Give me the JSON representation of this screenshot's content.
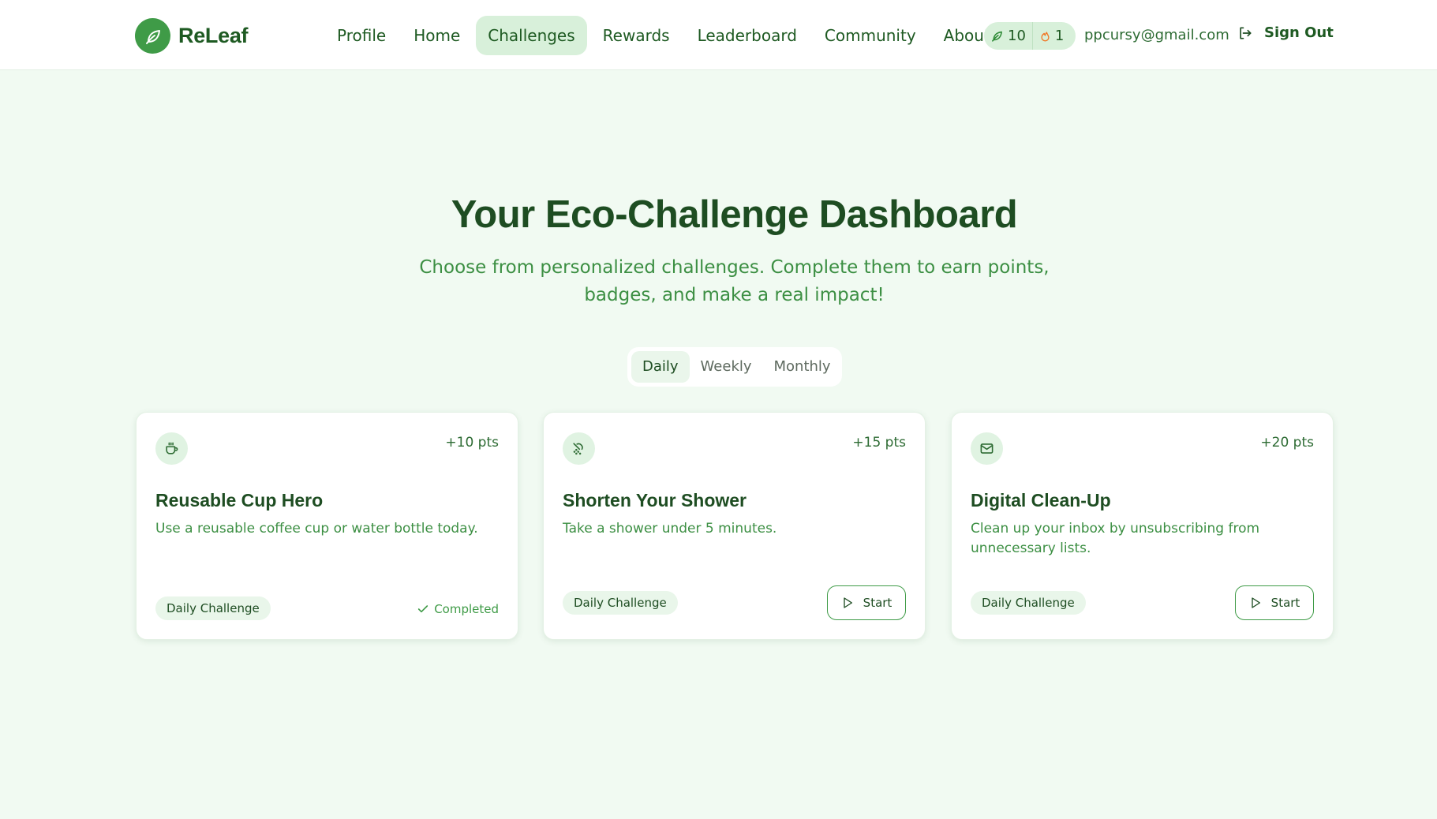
{
  "brand": {
    "name": "ReLeaf",
    "logo_icon": "leaf-icon"
  },
  "nav": {
    "items": [
      "Profile",
      "Home",
      "Challenges",
      "Rewards",
      "Leaderboard",
      "Community",
      "About"
    ],
    "active": "Challenges"
  },
  "stats": {
    "leaves": "10",
    "streak": "1"
  },
  "user": {
    "email": "ppcursy@gmail.com",
    "sign_out_label": "Sign Out"
  },
  "hero": {
    "title": "Your Eco-Challenge Dashboard",
    "subtitle": "Choose from personalized challenges. Complete them to earn points, badges, and make a real impact!"
  },
  "tabs": {
    "items": [
      "Daily",
      "Weekly",
      "Monthly"
    ],
    "active": "Daily"
  },
  "cards": [
    {
      "icon": "cup-icon",
      "points": "+10 pts",
      "title": "Reusable Cup Hero",
      "description": "Use a reusable coffee cup or water bottle today.",
      "badge": "Daily Challenge",
      "status": "Completed"
    },
    {
      "icon": "shower-icon",
      "points": "+15 pts",
      "title": "Shorten Your Shower",
      "description": "Take a shower under 5 minutes.",
      "badge": "Daily Challenge",
      "action": "Start"
    },
    {
      "icon": "mail-icon",
      "points": "+20 pts",
      "title": "Digital Clean-Up",
      "description": "Clean up your inbox by unsubscribing from unnecessary lists.",
      "badge": "Daily Challenge",
      "action": "Start"
    }
  ],
  "colors": {
    "accent": "#3f9b47",
    "primary_text": "#1e4d22",
    "page_bg": "#f1faf2",
    "active_pill": "#d8f0da",
    "flame": "#f07a2a"
  }
}
